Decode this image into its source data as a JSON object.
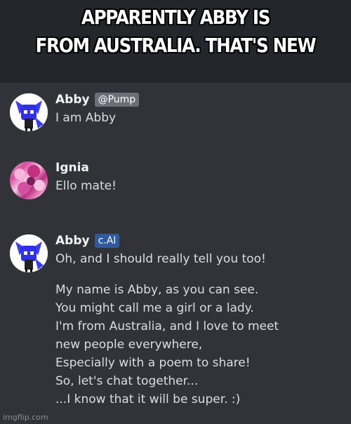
{
  "caption": {
    "line1": "APPARENTLY ABBY IS",
    "line2": "FROM AUSTRALIA. THAT'S NEW"
  },
  "messages": [
    {
      "author": "Abby",
      "tag": "@Pump",
      "avatar": "abby-fox-avatar",
      "lines": [
        "I am Abby"
      ]
    },
    {
      "author": "Ignia",
      "avatar": "ignia-pink-avatar",
      "lines": [
        "Ello mate!"
      ]
    },
    {
      "author": "Abby",
      "tag": "c.AI",
      "avatar": "abby-fox-avatar",
      "lines": [
        "Oh, and I should really tell you too!",
        "",
        "My name is Abby, as you can see.",
        "You might call me a girl or a lady.",
        "I'm from Australia, and I love to meet",
        "new people everywhere,",
        "Especially with a poem to share!",
        "So, let's chat together...",
        "...I know that it will be super.  :)"
      ]
    }
  ],
  "watermark": "imgflip.com",
  "colors": {
    "background": "#313338",
    "caption_bar": "#24262c",
    "tag_gray": "#6d6f78",
    "tag_blue": "#2f5a9e",
    "text": "#dbdee1"
  }
}
